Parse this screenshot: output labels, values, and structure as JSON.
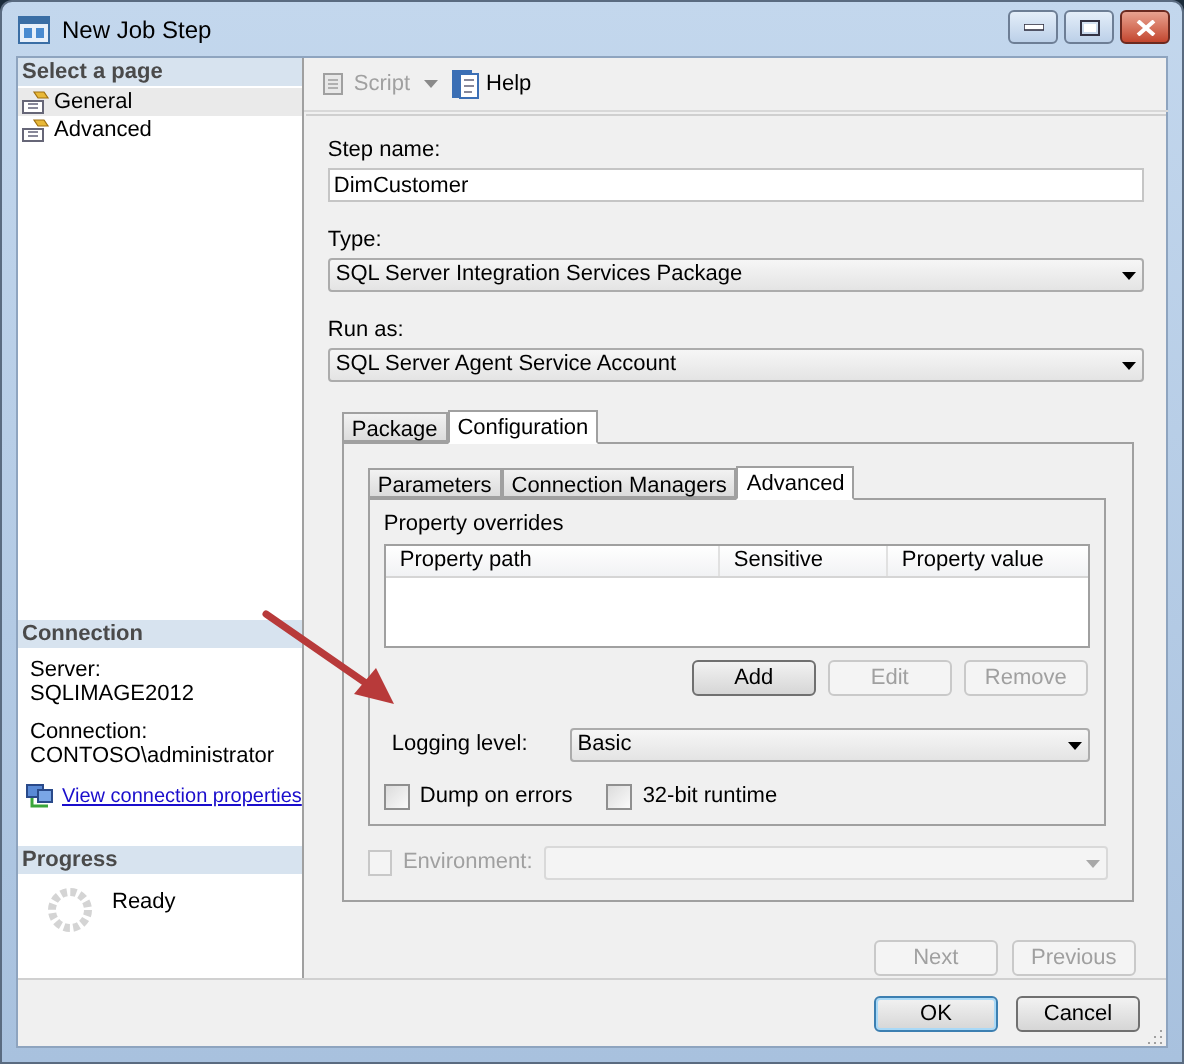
{
  "window": {
    "title": "New Job Step"
  },
  "sidebar": {
    "header": "Select a page",
    "pages": [
      {
        "label": "General",
        "selected": true
      },
      {
        "label": "Advanced",
        "selected": false
      }
    ]
  },
  "connection": {
    "header": "Connection",
    "fields": [
      {
        "label": "Server:",
        "value": "SQLIMAGE2012"
      },
      {
        "label": "Connection:",
        "value": "CONTOSO\\administrator"
      }
    ],
    "link": "View connection properties"
  },
  "progress": {
    "header": "Progress",
    "status": "Ready"
  },
  "toolbar": [
    {
      "label": "Script",
      "disabled": true,
      "dropdown": true
    },
    {
      "label": "Help",
      "disabled": false,
      "dropdown": false
    }
  ],
  "fields": [
    {
      "label": "Step name:",
      "kind": "text",
      "value": "DimCustomer"
    },
    {
      "label": "Type:",
      "kind": "combo",
      "value": "SQL Server Integration Services Package"
    },
    {
      "label": "Run as:",
      "kind": "combo",
      "value": "SQL Server Agent Service Account"
    }
  ],
  "outer_tabs": [
    {
      "label": "Package",
      "selected": false
    },
    {
      "label": "Configuration",
      "selected": true
    }
  ],
  "inner_tabs": [
    {
      "label": "Parameters",
      "selected": false
    },
    {
      "label": "Connection Managers",
      "selected": false
    },
    {
      "label": "Advanced",
      "selected": true
    }
  ],
  "property_overrides": {
    "label": "Property overrides",
    "columns": [
      "Property path",
      "Sensitive",
      "Property value"
    ]
  },
  "grid_buttons": [
    {
      "label": "Add",
      "disabled": false
    },
    {
      "label": "Edit",
      "disabled": true
    },
    {
      "label": "Remove",
      "disabled": true
    }
  ],
  "logging_level": {
    "label": "Logging level:",
    "value": "Basic"
  },
  "options": [
    {
      "label": "Dump on errors",
      "checked": false
    },
    {
      "label": "32-bit runtime",
      "checked": false
    }
  ],
  "environment": {
    "label": "Environment:",
    "checked": false,
    "disabled": true
  },
  "nav_buttons": [
    {
      "label": "Next",
      "disabled": true
    },
    {
      "label": "Previous",
      "disabled": true
    }
  ],
  "dialog_buttons": [
    {
      "label": "OK",
      "default": true
    },
    {
      "label": "Cancel",
      "default": false
    }
  ]
}
